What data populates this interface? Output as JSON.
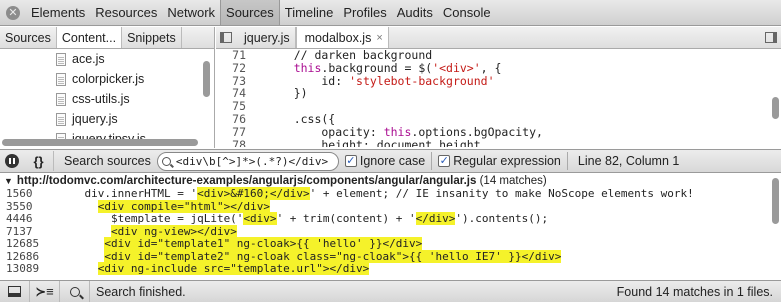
{
  "toolbar": {
    "close_glyph": "✕",
    "panels": [
      "Elements",
      "Resources",
      "Network",
      "Sources",
      "Timeline",
      "Profiles",
      "Audits",
      "Console"
    ],
    "active_panel": "Sources"
  },
  "navigator": {
    "tabs": [
      "Sources",
      "Content...",
      "Snippets"
    ],
    "active_tab": "Content...",
    "files": [
      "ace.js",
      "colorpicker.js",
      "css-utils.js",
      "jquery.js",
      "jquery.tipsy.js"
    ]
  },
  "editor": {
    "tabs": [
      {
        "label": "jquery.js"
      },
      {
        "label": "modalbox.js",
        "close": "×"
      }
    ],
    "lines": [
      {
        "num": "71",
        "text": "    // darken background"
      },
      {
        "num": "72",
        "text": "    this.background = $('<div>', {"
      },
      {
        "num": "73",
        "text": "        id: 'stylebot-background'"
      },
      {
        "num": "74",
        "text": "    })"
      },
      {
        "num": "75",
        "text": ""
      },
      {
        "num": "76",
        "text": "    .css({"
      },
      {
        "num": "77",
        "text": "        opacity: this.options.bgOpacity,"
      },
      {
        "num": "78",
        "text": "        height: document.height"
      }
    ]
  },
  "searchbar": {
    "label": "Search sources",
    "query": "<div\\b[^>]*>(.*?)</div>",
    "ignore_case_label": "Ignore case",
    "regex_label": "Regular expression",
    "check_glyph": "✓",
    "line_col": "Line 82, Column 1"
  },
  "results": {
    "triangle": "▼",
    "file_url": "http://todomvc.com/architecture-examples/angularjs/components/angular/angular.js",
    "match_count": "(14 matches)",
    "lines": [
      {
        "num": "1560",
        "pre": "    div.innerHTML = '",
        "hl": "<div>&#160;</div>",
        "post": "' + element; // IE insanity to make NoScope elements work!"
      },
      {
        "num": "3550",
        "pre": "      ",
        "hl": "<div compile=\"html\"></div>",
        "post": ""
      },
      {
        "num": "4446",
        "pre": "        $template = jqLite('",
        "hl": "<div>",
        "mid": "' + trim(content) + '",
        "hl2": "</div>",
        "post": "').contents();"
      },
      {
        "num": "7137",
        "pre": "        ",
        "hl": "<div ng-view></div>",
        "post": ""
      },
      {
        "num": "12685",
        "pre": "       ",
        "hl": "<div id=\"template1\" ng-cloak>{{ 'hello' }}</div>",
        "post": ""
      },
      {
        "num": "12686",
        "pre": "       ",
        "hl": "<div id=\"template2\" ng-cloak class=\"ng-cloak\">{{ 'hello IE7' }}</div>",
        "post": ""
      },
      {
        "num": "13089",
        "pre": "      ",
        "hl": "<div ng-include src=\"template.url\"></div>",
        "post": ""
      }
    ]
  },
  "statusbar": {
    "console_glyph": "≻≡",
    "status": "Search finished.",
    "found": "Found 14 matches in 1 files."
  }
}
